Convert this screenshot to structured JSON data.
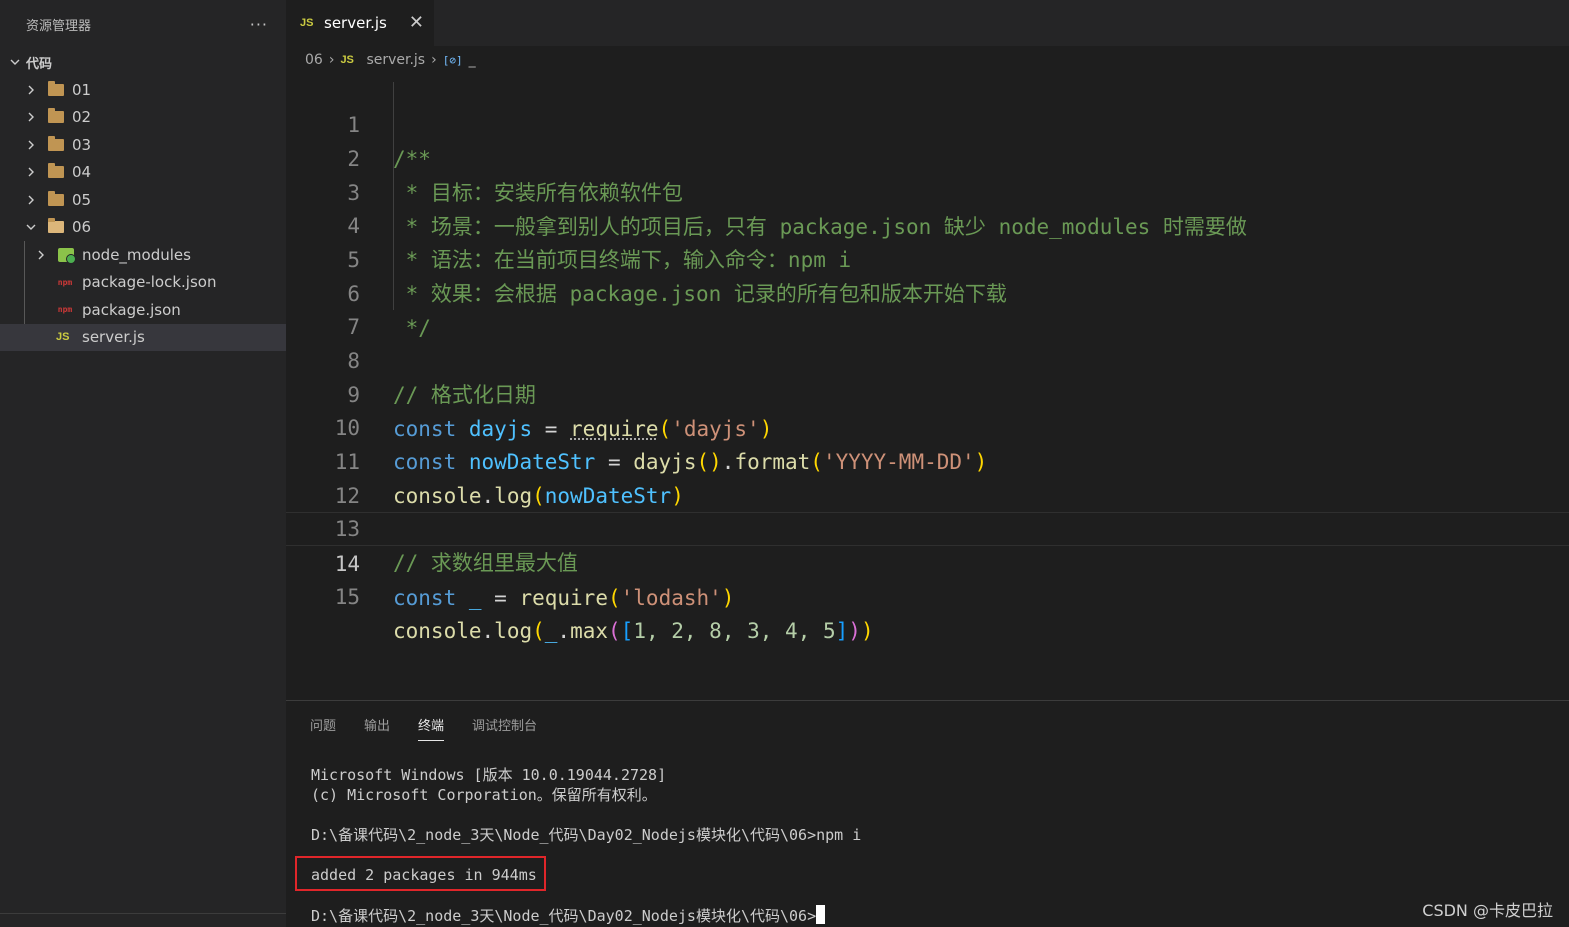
{
  "sidebar": {
    "title": "资源管理器",
    "more": "···",
    "root": "代码",
    "folders": [
      "01",
      "02",
      "03",
      "04",
      "05",
      "06"
    ],
    "children": {
      "node_modules": "node_modules",
      "package_lock": "package-lock.json",
      "package": "package.json",
      "server": "server.js"
    },
    "icons": {
      "folder": "folder-icon",
      "json": "json-icon",
      "js": "js-icon"
    }
  },
  "tab": {
    "icon": "JS",
    "label": "server.js",
    "close": "✕"
  },
  "breadcrumb": {
    "folder": "06",
    "icon": "JS",
    "file": "server.js",
    "symbol_icon": "[⊘]",
    "symbol": "_"
  },
  "editor": {
    "line_numbers": [
      "1",
      "2",
      "3",
      "4",
      "5",
      "6",
      "7",
      "8",
      "9",
      "10",
      "11",
      "12",
      "13",
      "14",
      "15"
    ],
    "active_line": 14,
    "comments": {
      "l1": "/**",
      "l2": " * 目标：安装所有依赖软件包",
      "l3": " * 场景：一般拿到别人的项目后，只有 package.json 缺少 node_modules 时需要做",
      "l4": " * 语法：在当前项目终端下，输入命令：npm i",
      "l5": " * 效果：会根据 package.json 记录的所有包和版本开始下载",
      "l6": " */",
      "l8": "// 格式化日期",
      "l13": "// 求数组里最大值"
    },
    "tokens": {
      "const": "const",
      "dayjs": "dayjs",
      "eq": " = ",
      "require": "require",
      "lp": "(",
      "rp": ")",
      "str_dayjs": "'dayjs'",
      "nowDateStr": "nowDateStr",
      "dayjs_call": "dayjs",
      "dot": ".",
      "format": "format",
      "str_fmt": "'YYYY-MM-DD'",
      "console": "console",
      "log": "log",
      "underscore": "_",
      "str_lodash": "'lodash'",
      "max": "max",
      "lb": "[",
      "rb": "]",
      "arr": "1, 2, 8, 3, 4, 5"
    }
  },
  "panel": {
    "tabs": [
      "问题",
      "输出",
      "终端",
      "调试控制台"
    ],
    "active_tab": "终端",
    "terminal": [
      "Microsoft Windows [版本 10.0.19044.2728]",
      "(c) Microsoft Corporation。保留所有权利。",
      "D:\\备课代码\\2_node_3天\\Node_代码\\Day02_Nodejs模块化\\代码\\06>npm i",
      "added 2 packages in 944ms",
      "D:\\备课代码\\2_node_3天\\Node_代码\\Day02_Nodejs模块化\\代码\\06>"
    ]
  },
  "watermark": "CSDN @卡皮巴拉",
  "colors": {
    "comment": "#6a9955",
    "keyword": "#569cd6",
    "variable": "#4fc1ff",
    "function": "#dcdcaa",
    "string": "#ce9178",
    "highlight_box": "#e0262a"
  }
}
